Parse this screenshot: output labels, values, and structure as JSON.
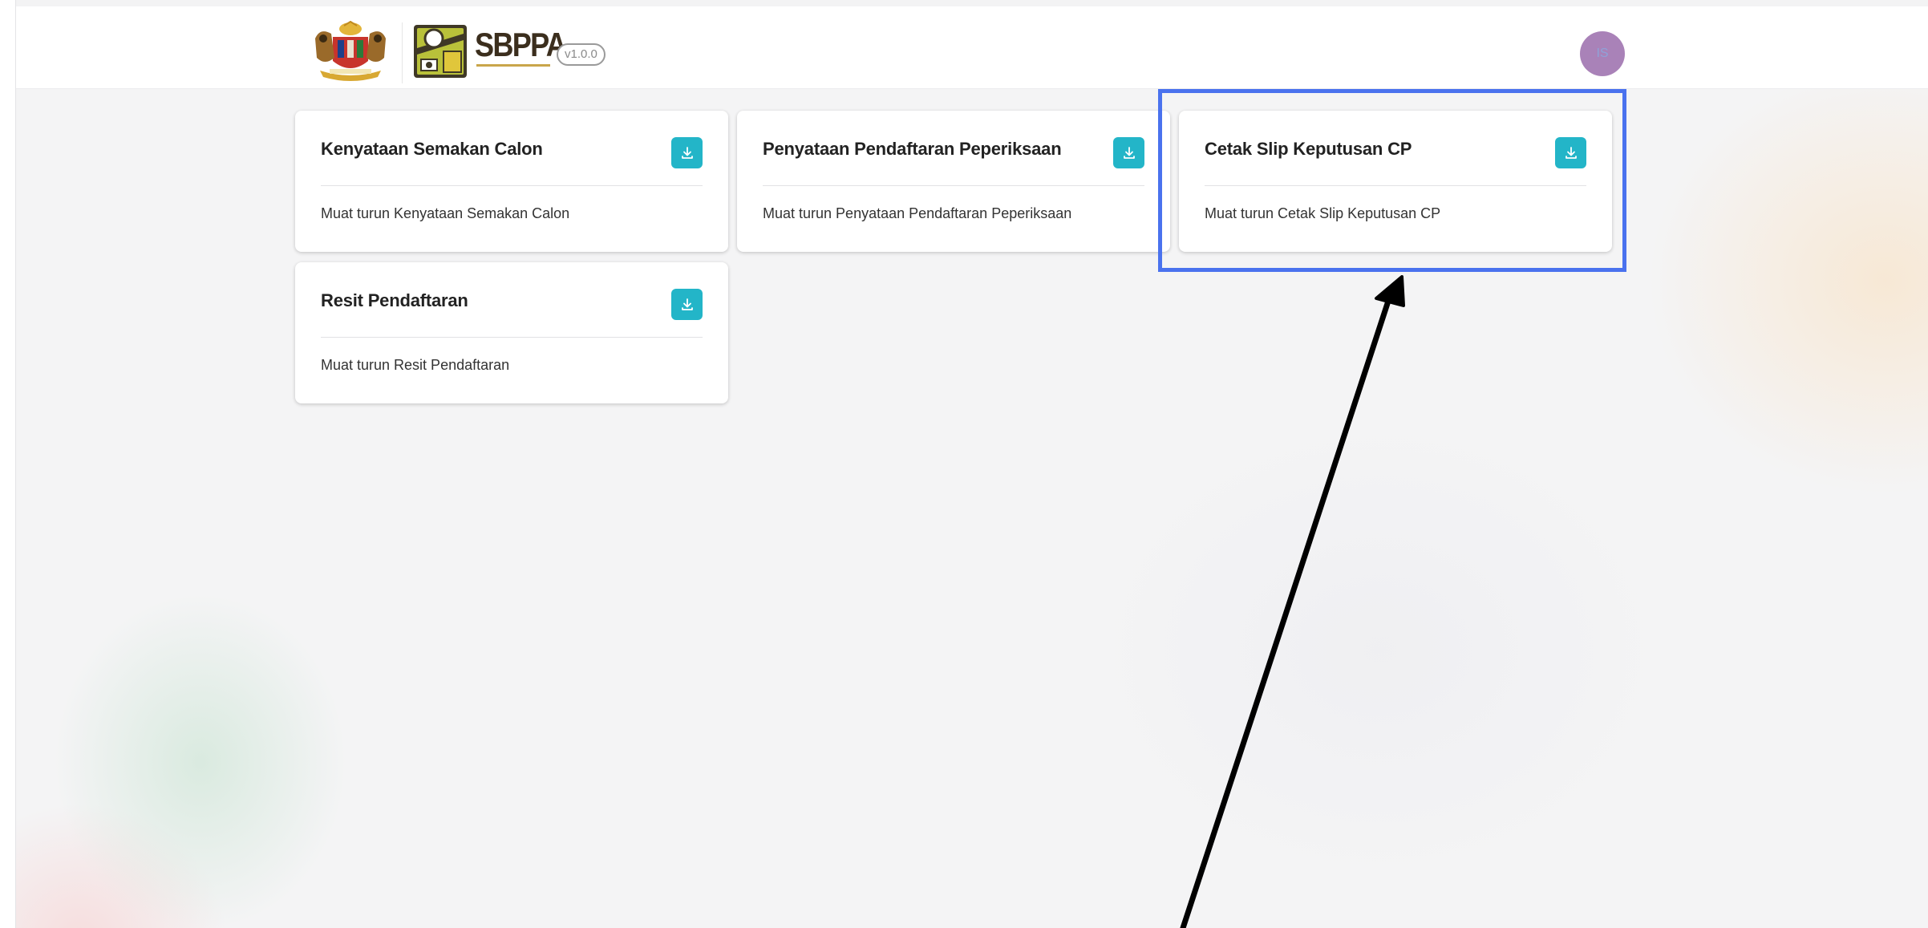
{
  "header": {
    "brand_name": "SBPPA",
    "version": "v1.0.0",
    "user_initials": "IS"
  },
  "cards": [
    {
      "title": "Kenyataan Semakan Calon",
      "description": "Muat turun Kenyataan Semakan Calon",
      "icon": "download-icon"
    },
    {
      "title": "Penyataan Pendaftaran Peperiksaan",
      "description": "Muat turun Penyataan Pendaftaran Peperiksaan",
      "icon": "download-icon"
    },
    {
      "title": "Cetak Slip Keputusan CP",
      "description": "Muat turun Cetak Slip Keputusan CP",
      "icon": "download-icon"
    },
    {
      "title": "Resit Pendaftaran",
      "description": "Muat turun Resit Pendaftaran",
      "icon": "download-icon"
    }
  ],
  "colors": {
    "accent": "#23b5c8",
    "highlight": "#4a72ee",
    "avatar": "#a982b8"
  }
}
